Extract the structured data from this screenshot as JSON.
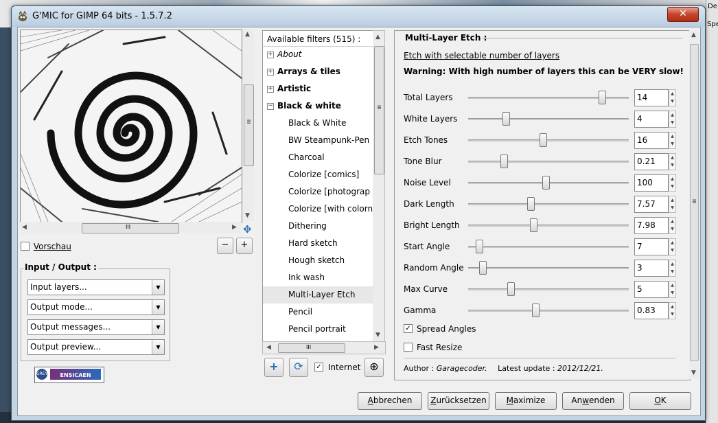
{
  "window": {
    "title": "G'MIC for GIMP 64 bits - 1.5.7.2",
    "close_glyph": "✕"
  },
  "desktop": {
    "side_text_1": "De",
    "side_text_2": "Spe"
  },
  "preview": {
    "checkbox_label": "Vorschau",
    "checked": false,
    "scroll_up": "▲",
    "scroll_down": "▼",
    "scroll_left": "◀",
    "scroll_right": "▶",
    "grip": "III",
    "move_glyph": "✥",
    "zoom_out": "−",
    "zoom_in": "+"
  },
  "io": {
    "title": "Input / Output :",
    "combos": [
      "Input layers...",
      "Output mode...",
      "Output messages...",
      "Output preview..."
    ],
    "drop_glyph": "▼"
  },
  "logo": {
    "text_1": "GREYC",
    "text_2": "ENSICAEN"
  },
  "filters": {
    "header": "Available filters (515) :",
    "items": [
      {
        "label": "About",
        "style": "italic",
        "expander": "+"
      },
      {
        "label": "Arrays & tiles",
        "style": "bold",
        "expander": "+"
      },
      {
        "label": "Artistic",
        "style": "bold",
        "expander": "+"
      },
      {
        "label": "Black & white",
        "style": "bold",
        "expander": "−"
      },
      {
        "label": "Black & White",
        "style": "child"
      },
      {
        "label": "BW Steampunk-Pen",
        "style": "child"
      },
      {
        "label": "Charcoal",
        "style": "child"
      },
      {
        "label": "Colorize [comics]",
        "style": "child"
      },
      {
        "label": "Colorize [photograp",
        "style": "child"
      },
      {
        "label": "Colorize [with colorn",
        "style": "child"
      },
      {
        "label": "Dithering",
        "style": "child"
      },
      {
        "label": "Hard sketch",
        "style": "child"
      },
      {
        "label": "Hough sketch",
        "style": "child"
      },
      {
        "label": "Ink wash",
        "style": "child"
      },
      {
        "label": "Multi-Layer Etch",
        "style": "child",
        "selected": true
      },
      {
        "label": "Pencil",
        "style": "child"
      },
      {
        "label": "Pencil portrait",
        "style": "child"
      }
    ],
    "internet_label": "Internet",
    "internet_checked": true,
    "add_glyph": "+",
    "refresh_glyph": "⟳",
    "search_glyph": "⊕"
  },
  "params": {
    "title": "Multi-Layer Etch :",
    "link": "Etch with selectable number of layers",
    "warning": "Warning: With high number of layers this can be VERY slow!",
    "sliders": [
      {
        "label": "Total Layers",
        "value": "14",
        "level": 0.84
      },
      {
        "label": "White Layers",
        "value": "4",
        "level": 0.22
      },
      {
        "label": "Etch Tones",
        "value": "16",
        "level": 0.46
      },
      {
        "label": "Tone Blur",
        "value": "0.21",
        "level": 0.21
      },
      {
        "label": "Noise Level",
        "value": "100",
        "level": 0.48
      },
      {
        "label": "Dark Length",
        "value": "7.57",
        "level": 0.38
      },
      {
        "label": "Bright Length",
        "value": "7.98",
        "level": 0.4
      },
      {
        "label": "Start Angle",
        "value": "7",
        "level": 0.05
      },
      {
        "label": "Random Angle",
        "value": "3",
        "level": 0.07
      },
      {
        "label": "Max Curve",
        "value": "5",
        "level": 0.25
      },
      {
        "label": "Gamma",
        "value": "0.83",
        "level": 0.41
      }
    ],
    "spin_up": "▲",
    "spin_down": "▼",
    "checks": [
      {
        "label": "Spread Angles",
        "checked": true
      },
      {
        "label": "Fast Resize",
        "checked": false
      }
    ],
    "author_label": "Author :",
    "author": "Garagecoder.",
    "update_label": "Latest update :",
    "update": "2012/12/21."
  },
  "buttons": [
    {
      "label": "Abbrechen",
      "u": "A"
    },
    {
      "label": "Zurücksetzen",
      "u": "Z"
    },
    {
      "label": "Maximize",
      "u": "M"
    },
    {
      "label": "Anwenden",
      "u": "w"
    },
    {
      "label": "OK",
      "u": "O"
    }
  ]
}
